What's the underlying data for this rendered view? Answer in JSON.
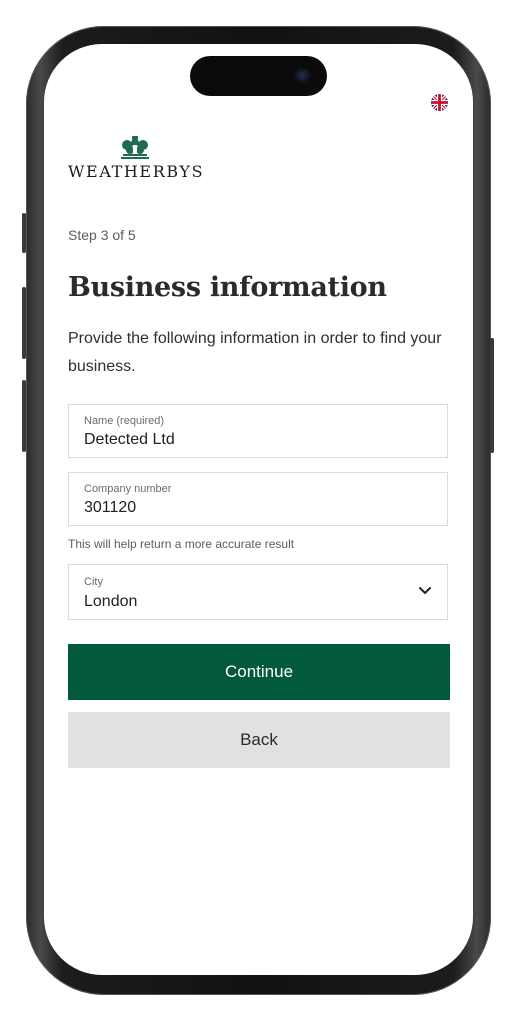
{
  "header": {
    "language_icon": "uk-flag-icon",
    "brand_icon": "weatherbys-crest-icon",
    "brand_name": "WEATHERBYS",
    "brand_color": "#03593c"
  },
  "step": {
    "text": "Step 3 of 5"
  },
  "page": {
    "title": "Business information",
    "description": "Provide the following information in order to find your business."
  },
  "form": {
    "name": {
      "label": "Name (required)",
      "value": "Detected Ltd"
    },
    "company_number": {
      "label": "Company number",
      "value": "301120",
      "hint": "This will help return a more accurate result"
    },
    "city": {
      "label": "City",
      "value": "London",
      "icon": "chevron-down-icon"
    }
  },
  "actions": {
    "continue_label": "Continue",
    "back_label": "Back",
    "primary_color": "#03593c",
    "secondary_color": "#e1e1e1"
  }
}
